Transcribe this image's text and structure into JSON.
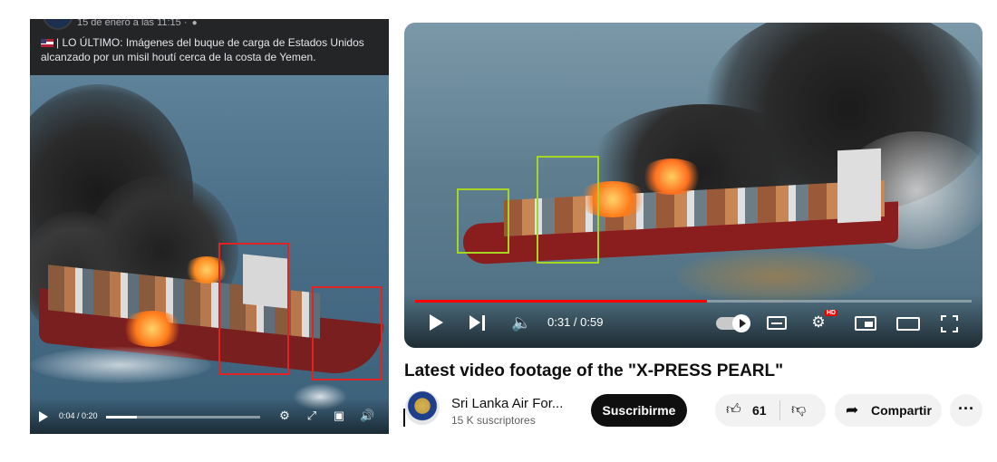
{
  "facebook_post": {
    "timestamp": "15 de enero a las 11:15 ·",
    "text": "| LO ÚLTIMO: Imágenes del buque de carga de Estados Unidos alcanzado por un misil houtí cerca de la costa de Yemen.",
    "player": {
      "time_display": "0:04 / 0:20",
      "progress": 0.2
    },
    "highlight_color": "#e02424"
  },
  "youtube": {
    "title": "Latest video footage of the \"X-PRESS PEARL\"",
    "player": {
      "time_display": "0:31 / 0:59",
      "progress": 0.525,
      "hd_badge": "HD"
    },
    "channel": {
      "name": "Sri Lanka Air For...",
      "subscribers": "15 K suscriptores"
    },
    "subscribe_label": "Suscribirme",
    "like_count": "61",
    "share_label": "Compartir",
    "highlight_color": "#a6d623"
  }
}
